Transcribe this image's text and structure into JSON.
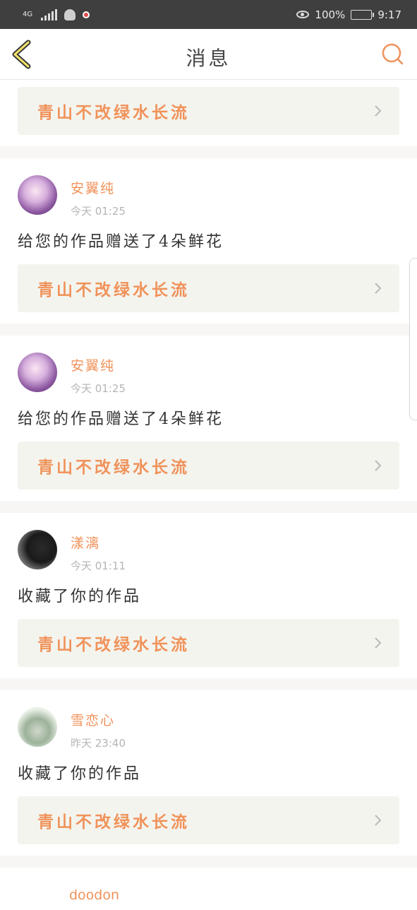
{
  "status_bar": {
    "network": "4G",
    "battery": "100%",
    "time": "9:17",
    "icons": [
      "signal-icon",
      "qq-icon",
      "notification-icon",
      "eye-icon",
      "battery-icon"
    ]
  },
  "header": {
    "title": "消息",
    "back_icon": "chevron-left-icon",
    "search_icon": "search-icon",
    "accent_color": "#f0925a"
  },
  "top_card": {
    "title": "青山不改绿水长流"
  },
  "messages": [
    {
      "username": "安翼纯",
      "time": "今天 01:25",
      "action": "给您的作品赠送了4朵鲜花",
      "work_title": "青山不改绿水长流"
    },
    {
      "username": "安翼纯",
      "time": "今天 01:25",
      "action": "给您的作品赠送了4朵鲜花",
      "work_title": "青山不改绿水长流"
    },
    {
      "username": "漾漓",
      "time": "今天 01:11",
      "action": "收藏了你的作品",
      "work_title": "青山不改绿水长流"
    },
    {
      "username": "雪恋心",
      "time": "昨天 23:40",
      "action": "收藏了你的作品",
      "work_title": "青山不改绿水长流"
    }
  ],
  "partial_message": {
    "username": "doodon"
  }
}
